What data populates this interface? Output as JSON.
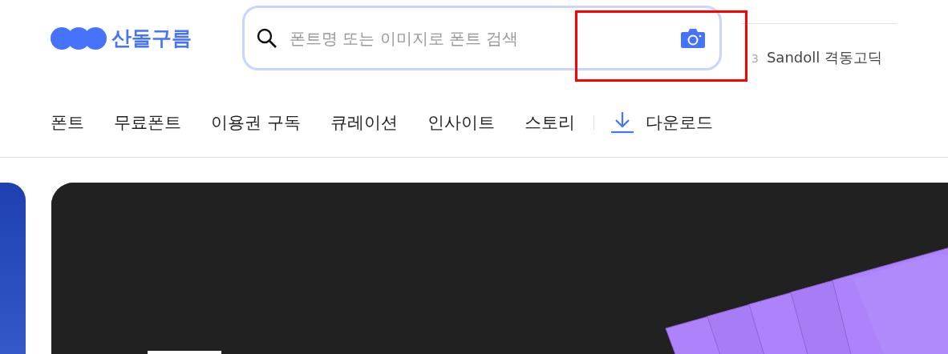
{
  "logo": {
    "text": "산돌구름"
  },
  "search": {
    "placeholder": "폰트명 또는 이미지로 폰트 검색"
  },
  "ranking": {
    "rank": "3",
    "name": "Sandoll 격동고딕"
  },
  "nav": [
    {
      "label": "폰트"
    },
    {
      "label": "무료폰트"
    },
    {
      "label": "이용권 구독"
    },
    {
      "label": "큐레이션"
    },
    {
      "label": "인사이트"
    },
    {
      "label": "스토리"
    }
  ],
  "download": {
    "label": "다운로드"
  }
}
